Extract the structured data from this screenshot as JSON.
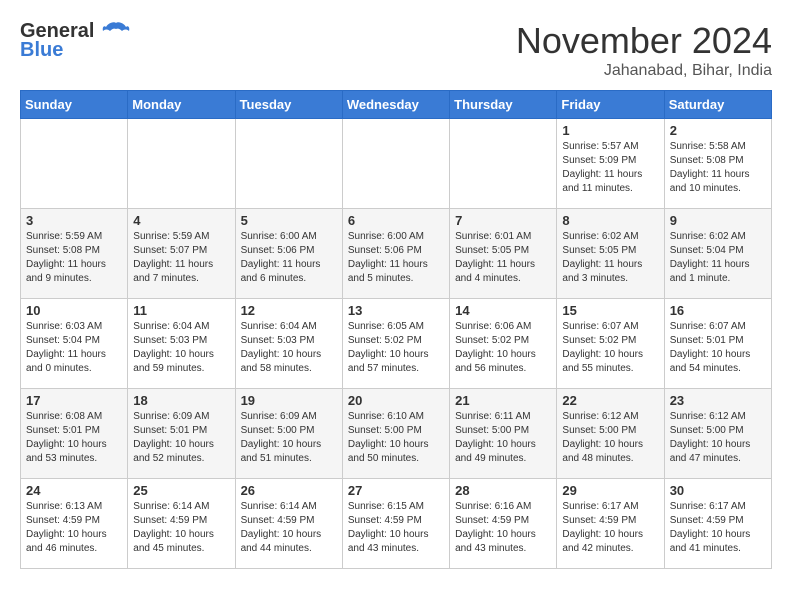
{
  "header": {
    "logo_general": "General",
    "logo_blue": "Blue",
    "month_title": "November 2024",
    "location": "Jahanabad, Bihar, India"
  },
  "weekdays": [
    "Sunday",
    "Monday",
    "Tuesday",
    "Wednesday",
    "Thursday",
    "Friday",
    "Saturday"
  ],
  "weeks": [
    [
      {
        "day": "",
        "info": ""
      },
      {
        "day": "",
        "info": ""
      },
      {
        "day": "",
        "info": ""
      },
      {
        "day": "",
        "info": ""
      },
      {
        "day": "",
        "info": ""
      },
      {
        "day": "1",
        "info": "Sunrise: 5:57 AM\nSunset: 5:09 PM\nDaylight: 11 hours\nand 11 minutes."
      },
      {
        "day": "2",
        "info": "Sunrise: 5:58 AM\nSunset: 5:08 PM\nDaylight: 11 hours\nand 10 minutes."
      }
    ],
    [
      {
        "day": "3",
        "info": "Sunrise: 5:59 AM\nSunset: 5:08 PM\nDaylight: 11 hours\nand 9 minutes."
      },
      {
        "day": "4",
        "info": "Sunrise: 5:59 AM\nSunset: 5:07 PM\nDaylight: 11 hours\nand 7 minutes."
      },
      {
        "day": "5",
        "info": "Sunrise: 6:00 AM\nSunset: 5:06 PM\nDaylight: 11 hours\nand 6 minutes."
      },
      {
        "day": "6",
        "info": "Sunrise: 6:00 AM\nSunset: 5:06 PM\nDaylight: 11 hours\nand 5 minutes."
      },
      {
        "day": "7",
        "info": "Sunrise: 6:01 AM\nSunset: 5:05 PM\nDaylight: 11 hours\nand 4 minutes."
      },
      {
        "day": "8",
        "info": "Sunrise: 6:02 AM\nSunset: 5:05 PM\nDaylight: 11 hours\nand 3 minutes."
      },
      {
        "day": "9",
        "info": "Sunrise: 6:02 AM\nSunset: 5:04 PM\nDaylight: 11 hours\nand 1 minute."
      }
    ],
    [
      {
        "day": "10",
        "info": "Sunrise: 6:03 AM\nSunset: 5:04 PM\nDaylight: 11 hours\nand 0 minutes."
      },
      {
        "day": "11",
        "info": "Sunrise: 6:04 AM\nSunset: 5:03 PM\nDaylight: 10 hours\nand 59 minutes."
      },
      {
        "day": "12",
        "info": "Sunrise: 6:04 AM\nSunset: 5:03 PM\nDaylight: 10 hours\nand 58 minutes."
      },
      {
        "day": "13",
        "info": "Sunrise: 6:05 AM\nSunset: 5:02 PM\nDaylight: 10 hours\nand 57 minutes."
      },
      {
        "day": "14",
        "info": "Sunrise: 6:06 AM\nSunset: 5:02 PM\nDaylight: 10 hours\nand 56 minutes."
      },
      {
        "day": "15",
        "info": "Sunrise: 6:07 AM\nSunset: 5:02 PM\nDaylight: 10 hours\nand 55 minutes."
      },
      {
        "day": "16",
        "info": "Sunrise: 6:07 AM\nSunset: 5:01 PM\nDaylight: 10 hours\nand 54 minutes."
      }
    ],
    [
      {
        "day": "17",
        "info": "Sunrise: 6:08 AM\nSunset: 5:01 PM\nDaylight: 10 hours\nand 53 minutes."
      },
      {
        "day": "18",
        "info": "Sunrise: 6:09 AM\nSunset: 5:01 PM\nDaylight: 10 hours\nand 52 minutes."
      },
      {
        "day": "19",
        "info": "Sunrise: 6:09 AM\nSunset: 5:00 PM\nDaylight: 10 hours\nand 51 minutes."
      },
      {
        "day": "20",
        "info": "Sunrise: 6:10 AM\nSunset: 5:00 PM\nDaylight: 10 hours\nand 50 minutes."
      },
      {
        "day": "21",
        "info": "Sunrise: 6:11 AM\nSunset: 5:00 PM\nDaylight: 10 hours\nand 49 minutes."
      },
      {
        "day": "22",
        "info": "Sunrise: 6:12 AM\nSunset: 5:00 PM\nDaylight: 10 hours\nand 48 minutes."
      },
      {
        "day": "23",
        "info": "Sunrise: 6:12 AM\nSunset: 5:00 PM\nDaylight: 10 hours\nand 47 minutes."
      }
    ],
    [
      {
        "day": "24",
        "info": "Sunrise: 6:13 AM\nSunset: 4:59 PM\nDaylight: 10 hours\nand 46 minutes."
      },
      {
        "day": "25",
        "info": "Sunrise: 6:14 AM\nSunset: 4:59 PM\nDaylight: 10 hours\nand 45 minutes."
      },
      {
        "day": "26",
        "info": "Sunrise: 6:14 AM\nSunset: 4:59 PM\nDaylight: 10 hours\nand 44 minutes."
      },
      {
        "day": "27",
        "info": "Sunrise: 6:15 AM\nSunset: 4:59 PM\nDaylight: 10 hours\nand 43 minutes."
      },
      {
        "day": "28",
        "info": "Sunrise: 6:16 AM\nSunset: 4:59 PM\nDaylight: 10 hours\nand 43 minutes."
      },
      {
        "day": "29",
        "info": "Sunrise: 6:17 AM\nSunset: 4:59 PM\nDaylight: 10 hours\nand 42 minutes."
      },
      {
        "day": "30",
        "info": "Sunrise: 6:17 AM\nSunset: 4:59 PM\nDaylight: 10 hours\nand 41 minutes."
      }
    ]
  ]
}
